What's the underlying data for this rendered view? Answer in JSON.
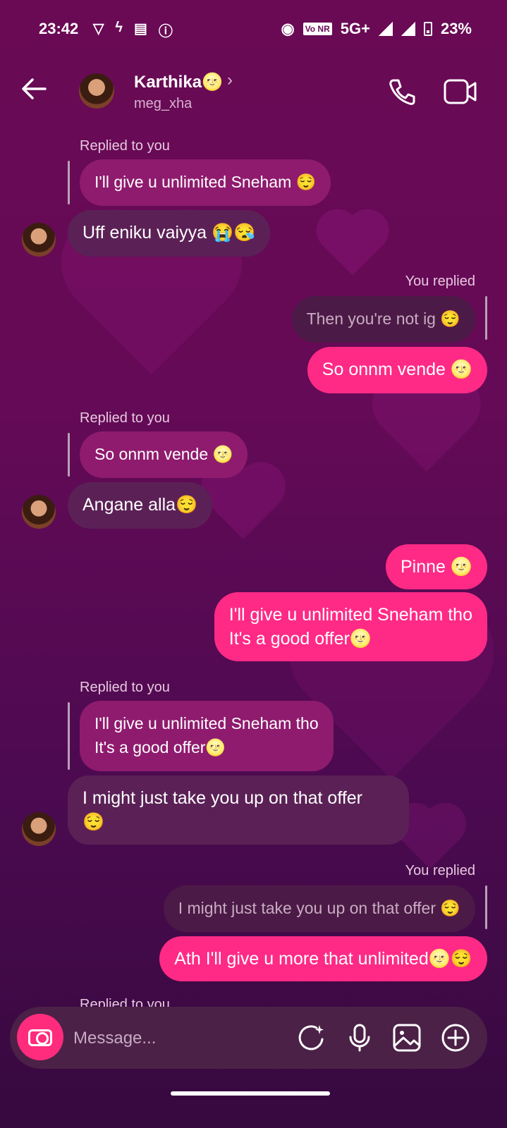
{
  "status": {
    "time": "23:42",
    "network": "5G+",
    "battery": "23%"
  },
  "header": {
    "name": "Karthika🌝",
    "username": "meg_xha",
    "chevron": "›"
  },
  "messages": {
    "m1_label": "Replied to you",
    "m1_quote": "I'll give u unlimited Sneham 😌",
    "m1_text": "Uff eniku vaiyya 😭😪",
    "m2_label": "You replied",
    "m2_quote": "Then you're not ig 😌",
    "m2_text": "So onnm vende 🌝",
    "m3_label": "Replied to you",
    "m3_quote": "So onnm vende 🌝",
    "m3_text": "Angane alla😌",
    "m4_text": "Pinne 🌝",
    "m5_line1": "I'll give u unlimited Sneham tho",
    "m5_line2": "It's a good offer🌝",
    "m6_label": "Replied to you",
    "m6_quote_line1": "I'll give u unlimited Sneham tho",
    "m6_quote_line2": "It's a good offer🌝",
    "m6_line1": "I might just take you up on that offer",
    "m6_line2": "😌",
    "m7_label": "You replied",
    "m7_quote": "I might just take you up on that offer 😌",
    "m7_text": "Ath I'll give u more that unlimited🌝😌",
    "m8_label": "Replied to you"
  },
  "composer": {
    "placeholder": "Message..."
  },
  "icons": {
    "back": "arrow-left",
    "call": "phone",
    "video": "video-camera",
    "camera": "camera",
    "sticker": "sparkle-sticker",
    "mic": "microphone",
    "gallery": "image",
    "more": "plus-circle"
  },
  "colors": {
    "incoming_bubble": "#5b2156",
    "outgoing_bubble": "#ff2a86",
    "quote_incoming": "#8f1b6e",
    "camera_button": "#ff2b7d"
  }
}
